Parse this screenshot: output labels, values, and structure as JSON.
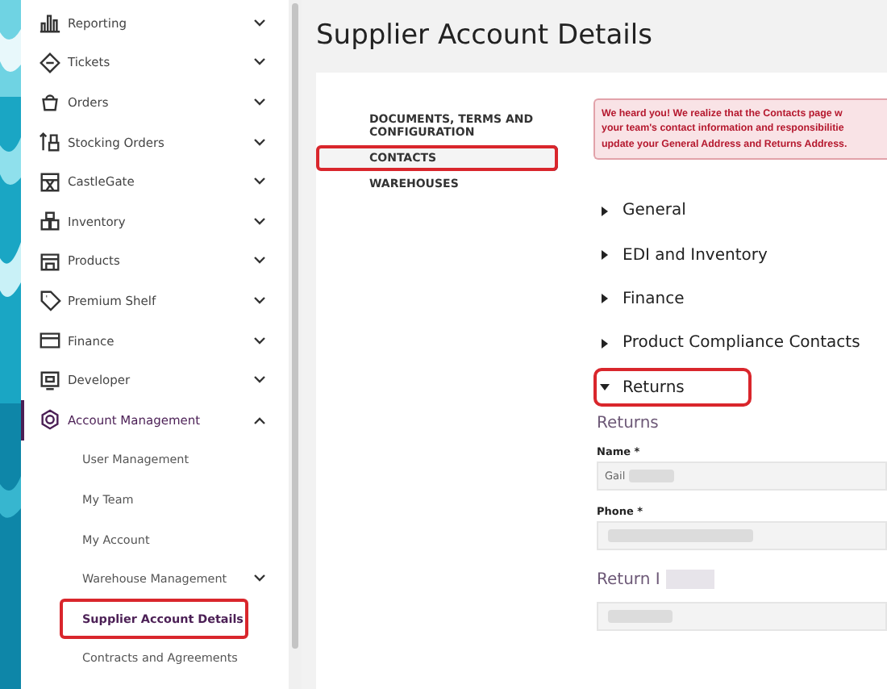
{
  "sidebar": {
    "items": [
      {
        "label": "Reporting",
        "expanded": false
      },
      {
        "label": "Tickets",
        "expanded": false
      },
      {
        "label": "Orders",
        "expanded": false
      },
      {
        "label": "Stocking Orders",
        "expanded": false
      },
      {
        "label": "CastleGate",
        "expanded": false
      },
      {
        "label": "Inventory",
        "expanded": false
      },
      {
        "label": "Products",
        "expanded": false
      },
      {
        "label": "Premium Shelf",
        "expanded": false
      },
      {
        "label": "Finance",
        "expanded": false
      },
      {
        "label": "Developer",
        "expanded": false
      },
      {
        "label": "Account Management",
        "expanded": true,
        "selected": true,
        "children": [
          {
            "label": "User Management",
            "selected": false,
            "highlighted": false,
            "has_children": false
          },
          {
            "label": "My Team",
            "selected": false,
            "highlighted": false,
            "has_children": false
          },
          {
            "label": "My Account",
            "selected": false,
            "highlighted": false,
            "has_children": false
          },
          {
            "label": "Warehouse Management",
            "selected": false,
            "highlighted": false,
            "has_children": true
          },
          {
            "label": "Supplier Account Details",
            "selected": true,
            "highlighted": true,
            "has_children": false
          },
          {
            "label": "Contracts and Agreements",
            "selected": false,
            "highlighted": false,
            "has_children": false
          }
        ]
      }
    ]
  },
  "page": {
    "title": "Supplier Account Details"
  },
  "tabs": [
    {
      "label": "DOCUMENTS, TERMS AND CONFIGURATION",
      "selected": false,
      "highlighted": false
    },
    {
      "label": "CONTACTS",
      "selected": true,
      "highlighted": true
    },
    {
      "label": "WAREHOUSES",
      "selected": false,
      "highlighted": false
    }
  ],
  "alert": {
    "lines": [
      "We heard you! We realize that the Contacts page w",
      "your team's contact information and responsibilitie",
      "update your General Address and Returns Address."
    ]
  },
  "sections": [
    {
      "label": "General",
      "expanded": false,
      "highlighted": false
    },
    {
      "label": "EDI and Inventory",
      "expanded": false,
      "highlighted": false
    },
    {
      "label": "Finance",
      "expanded": false,
      "highlighted": false
    },
    {
      "label": "Product Compliance Contacts",
      "expanded": false,
      "highlighted": false
    },
    {
      "label": "Returns",
      "expanded": true,
      "highlighted": true
    }
  ],
  "returns": {
    "heading": "Returns",
    "fields": [
      {
        "label": "Name *",
        "value": "Gail"
      },
      {
        "label": "Phone *"
      }
    ],
    "subheading": "Return I"
  }
}
